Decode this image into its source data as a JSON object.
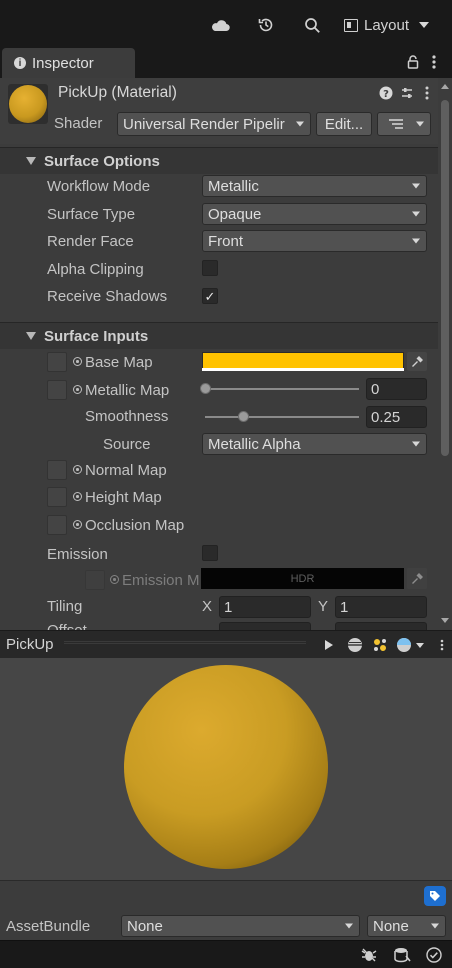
{
  "toolbar": {
    "layout_label": "Layout"
  },
  "tab": {
    "inspector_label": "Inspector"
  },
  "header": {
    "title": "PickUp (Material)",
    "shader_label": "Shader",
    "shader_value": "Universal Render Pipelir",
    "edit_label": "Edit..."
  },
  "surface_options": {
    "title": "Surface Options",
    "rows": [
      {
        "label": "Workflow Mode",
        "value": "Metallic"
      },
      {
        "label": "Surface Type",
        "value": "Opaque"
      },
      {
        "label": "Render Face",
        "value": "Front"
      }
    ],
    "alpha_clipping": {
      "label": "Alpha Clipping",
      "checked": false
    },
    "receive_shadows": {
      "label": "Receive Shadows",
      "checked": true
    }
  },
  "surface_inputs": {
    "title": "Surface Inputs",
    "base_map": {
      "label": "Base Map",
      "color": "#ffc200"
    },
    "metallic_map": {
      "label": "Metallic Map",
      "value": "0",
      "level": 0
    },
    "smoothness": {
      "label": "Smoothness",
      "value": "0.25",
      "level": 0.25
    },
    "source": {
      "label": "Source",
      "value": "Metallic Alpha"
    },
    "normal_map": {
      "label": "Normal Map"
    },
    "height_map": {
      "label": "Height Map"
    },
    "occlusion_map": {
      "label": "Occlusion Map"
    },
    "emission": {
      "label": "Emission",
      "checked": false
    },
    "emission_map": {
      "label": "Emission M",
      "hdr_label": "HDR"
    },
    "tiling": {
      "label": "Tiling",
      "x_label": "X",
      "x": "1",
      "y_label": "Y",
      "y": "1"
    },
    "offset": {
      "label": "Offset"
    }
  },
  "preview": {
    "title": "PickUp"
  },
  "asset_bundle": {
    "label": "AssetBundle",
    "name_value": "None",
    "variant_value": "None"
  },
  "colors": {
    "accent_blue": "#1e6fd0",
    "material_yellow": "#ffc200"
  }
}
